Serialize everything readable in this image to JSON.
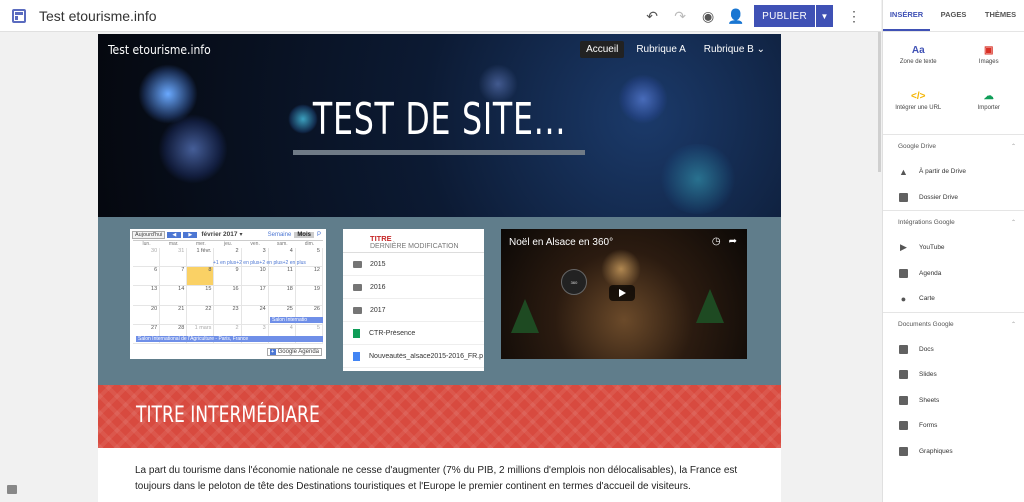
{
  "app": {
    "site_name": "Test etourisme.info"
  },
  "toolbar": {
    "undo_icon": "undo-icon",
    "redo_icon": "redo-icon",
    "preview_icon": "eye-icon",
    "share_icon": "add-person-icon",
    "publish_label": "PUBLIER",
    "more_icon": "more-vert-icon"
  },
  "hero": {
    "brand": "Test etourisme.info",
    "menu": [
      "Accueil",
      "Rubrique A",
      "Rubrique B"
    ],
    "title": "TEST DE SITE..."
  },
  "calendar": {
    "today_btn": "Aujourd'hui",
    "month": "février 2017",
    "tabs": [
      "Semaine",
      "Mois",
      "P"
    ],
    "day_headers": [
      "lun.",
      "mar.",
      "mer.",
      "jeu.",
      "ven.",
      "sam.",
      "dim."
    ],
    "weeks": [
      [
        "30",
        "31",
        "1 févr.",
        "2",
        "3",
        "4",
        "5"
      ],
      [
        "6",
        "7",
        "8",
        "9",
        "10",
        "11",
        "12"
      ],
      [
        "13",
        "14",
        "15",
        "16",
        "17",
        "18",
        "19"
      ],
      [
        "20",
        "21",
        "22",
        "23",
        "24",
        "25",
        "26"
      ],
      [
        "27",
        "28",
        "1 mars",
        "2",
        "3",
        "4",
        "5"
      ]
    ],
    "more_link": "+1 en plus+2 en plus+2 en plus+2 en plus",
    "event_short": "Salon Internatio",
    "event_long": "Salon International de l'Agriculture - Paris, France",
    "badge": "Google Agenda"
  },
  "drive": {
    "title": "TITRE",
    "subtitle": "DERNIÈRE MODIFICATION",
    "items": [
      {
        "label": "2015",
        "type": "folder"
      },
      {
        "label": "2016",
        "type": "folder"
      },
      {
        "label": "2017",
        "type": "folder"
      },
      {
        "label": "CTR-Présence",
        "type": "sheet"
      },
      {
        "label": "Nouveautés_alsace2015-2016_FR.p",
        "type": "doc"
      }
    ]
  },
  "video": {
    "title": "Noël en Alsace en 360°",
    "badge": "360"
  },
  "section": {
    "title": "TITRE INTERMÉDIARE",
    "body": "La part du tourisme dans l'économie nationale ne cesse d'augmenter (7% du PIB, 2 millions d'emplois non délocalisables), la France est toujours dans le peloton de tête des Destinations touristiques et l'Europe le premier continent en termes d'accueil de visiteurs."
  },
  "panel": {
    "tabs": [
      "INSÉRER",
      "PAGES",
      "THÈMES"
    ],
    "tiles": [
      {
        "glyph": "Aa",
        "label": "Zone de texte",
        "color": "#3f51b5"
      },
      {
        "glyph": "▣",
        "label": "Images",
        "color": "#d93025"
      },
      {
        "glyph": "</>",
        "label": "Intégrer une URL",
        "color": "#f4b400"
      },
      {
        "glyph": "☁",
        "label": "Importer",
        "color": "#0f9d58"
      }
    ],
    "sections": [
      {
        "title": "Google Drive",
        "items": [
          "À partir de Drive",
          "Dossier Drive"
        ]
      },
      {
        "title": "Intégrations Google",
        "items": [
          "YouTube",
          "Agenda",
          "Carte"
        ]
      },
      {
        "title": "Documents Google",
        "items": [
          "Docs",
          "Slides",
          "Sheets",
          "Forms",
          "Graphiques"
        ]
      }
    ]
  }
}
